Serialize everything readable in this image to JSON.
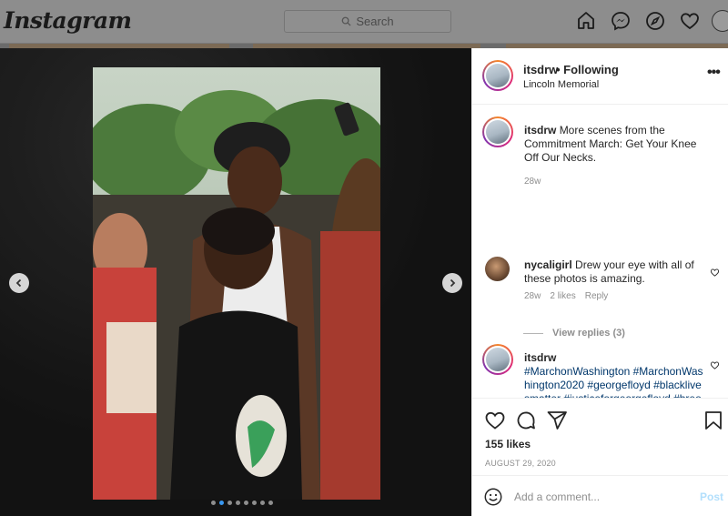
{
  "header": {
    "logo": "Instagram",
    "search_placeholder": "Search",
    "nav_icons": [
      "home-icon",
      "messenger-icon",
      "explore-icon",
      "heart-icon",
      "profile-avatar"
    ]
  },
  "post": {
    "username": "itsdrw",
    "follow_status": "• Following",
    "location": "Lincoln Memorial",
    "carousel": {
      "total": 8,
      "active": 1
    },
    "caption": {
      "username": "itsdrw",
      "text": "More scenes from the Commitment March: Get Your Knee Off Our Necks.",
      "age": "28w"
    },
    "comments": [
      {
        "username": "nycaligirl",
        "text": "Drew your eye with all of these photos is amazing.",
        "age": "28w",
        "likes": "2 likes",
        "reply": "Reply",
        "view_replies": "View replies (3)"
      },
      {
        "username": "itsdrw",
        "text": "#MarchonWashington #MarchonWashington2020 #georgefloyd #blacklivesmatter #justiceforgeorgefloyd #breonnataylor #justiceforbreonnataylor #activism #2020 #Marchonwashin"
      }
    ],
    "likes_count": "155 likes",
    "date": "AUGUST 29, 2020",
    "add_comment_placeholder": "Add a comment...",
    "post_button": "Post"
  },
  "colors": {
    "link": "#00376b",
    "accent": "#3897f0",
    "post_disabled": "#b2dffc"
  }
}
